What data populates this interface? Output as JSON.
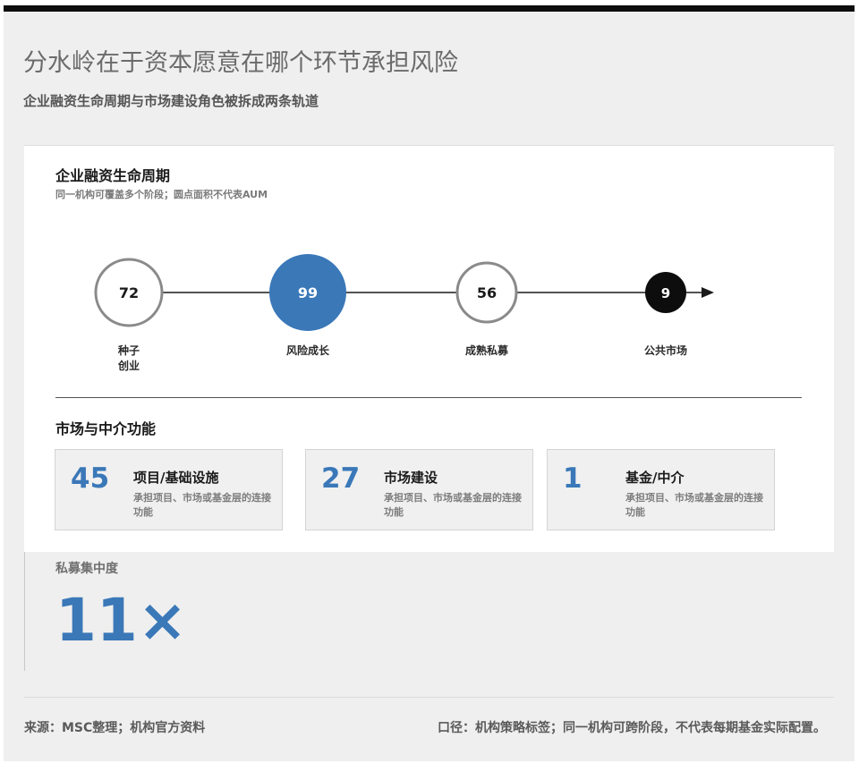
{
  "header": {
    "title": "分水岭在于资本愿意在哪个环节承担风险",
    "subtitle": "企业融资生命周期与市场建设角色被拆成两条轨道"
  },
  "lifecycle": {
    "title": "企业融资生命周期",
    "note": "同一机构可覆盖多个阶段；圆点面积不代表AUM",
    "stages": [
      {
        "count": "72",
        "label": "种子\n创业",
        "style": "outline"
      },
      {
        "count": "99",
        "label": "风险成长",
        "style": "filled-blue"
      },
      {
        "count": "56",
        "label": "成熟私募",
        "style": "outline"
      },
      {
        "count": "9",
        "label": "公共市场",
        "style": "filled-black"
      }
    ]
  },
  "functions": {
    "title": "市场与中介功能",
    "items": [
      {
        "count": "45",
        "name": "项目/基础设施",
        "desc": "承担项目、市场或基金层的连接功能"
      },
      {
        "count": "27",
        "name": "市场建设",
        "desc": "承担项目、市场或基金层的连接功能"
      },
      {
        "count": "1",
        "name": "基金/中介",
        "desc": "承担项目、市场或基金层的连接功能"
      }
    ]
  },
  "concentration": {
    "label": "私募集中度",
    "value": "11×"
  },
  "footer": {
    "source": "来源：MSC整理；机构官方资料",
    "note": "口径：机构策略标签；同一机构可跨阶段，不代表每期基金实际配置。"
  },
  "colors": {
    "accent_blue": "#3a78b8",
    "dark": "#0d0d0d",
    "outline_gray": "#8a8a8a"
  }
}
